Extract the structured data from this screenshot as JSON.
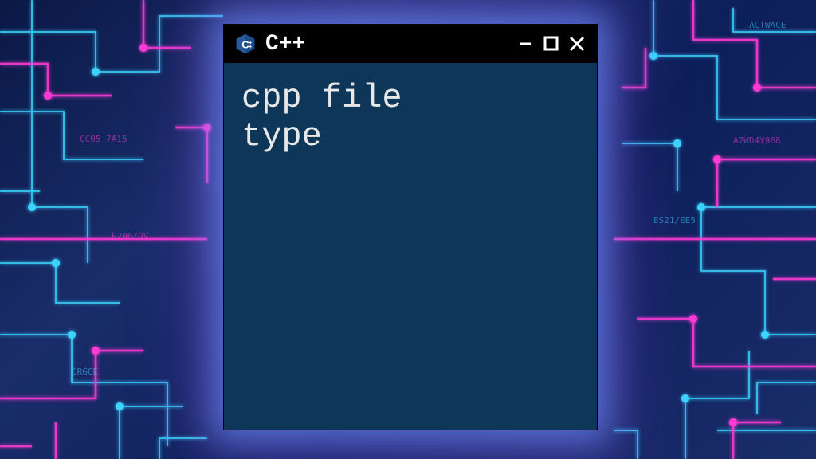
{
  "window": {
    "title": "C++",
    "icon_name": "cpp-logo-icon"
  },
  "content": {
    "text": "cpp file\ntype"
  },
  "colors": {
    "window_bg": "#0d3658",
    "titlebar_bg": "#000000",
    "text": "#e8e8e8",
    "glow_blue": "#6496ff",
    "glow_magenta": "#b450ff"
  }
}
